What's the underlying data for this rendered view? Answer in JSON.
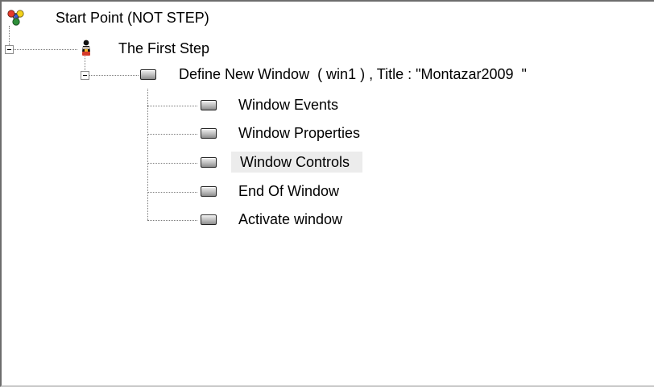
{
  "tree": {
    "root": {
      "label": "Start Point (NOT STEP)",
      "icon": "start-point-icon"
    },
    "step": {
      "label": "The First Step",
      "icon": "step-figure-icon"
    },
    "window_def": {
      "label": "Define New Window  ( win1 ) , Title : \"Montazar2009  \"",
      "icon": "window-icon"
    },
    "children": [
      {
        "label": "Window Events",
        "icon": "window-icon"
      },
      {
        "label": "Window Properties",
        "icon": "window-icon"
      },
      {
        "label": "Window Controls",
        "icon": "window-icon",
        "selected": true
      },
      {
        "label": "End Of Window",
        "icon": "window-icon"
      },
      {
        "label": "Activate window",
        "icon": "window-icon"
      }
    ]
  },
  "colors": {
    "selection_background": "#ececec",
    "connector_lines": "#7a7a7a",
    "border_dark": "#6d6d6d"
  }
}
